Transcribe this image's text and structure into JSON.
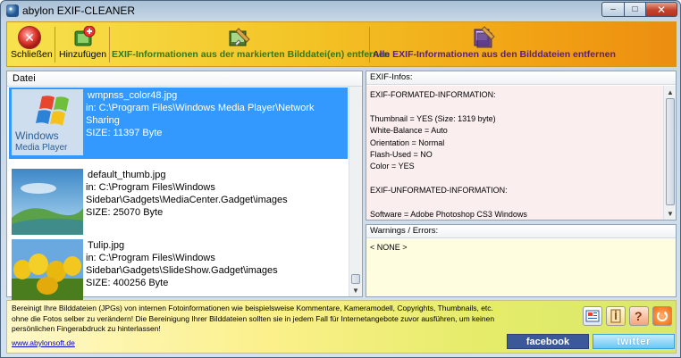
{
  "window": {
    "title": "abylon EXIF-CLEANER",
    "minimize_glyph": "–",
    "maximize_glyph": "□",
    "close_glyph": "✕"
  },
  "toolbar": {
    "close_label": "Schließen",
    "close_glyph": "✕",
    "add_label": "Hinzufügen",
    "remove_selected_label": "EXIF-Informationen aus der markierten Bilddatei(en) entfernen",
    "remove_all_label": "Alle EXIF-Informationen aus den Bilddateien entfernen",
    "remove_selected_color": "#2f7a1f",
    "remove_all_color": "#5b1c8c"
  },
  "file_list": {
    "header": "Datei",
    "files": [
      {
        "name": "wmpnss_color48.jpg",
        "path": "in: C:\\Program Files\\Windows Media Player\\Network Sharing",
        "size": "SIZE: 11397 Byte",
        "thumb_text_1": "Windows",
        "thumb_text_2": "Media Player",
        "selected": true
      },
      {
        "name": "default_thumb.jpg",
        "path": "in: C:\\Program Files\\Windows Sidebar\\Gadgets\\MediaCenter.Gadget\\images",
        "size": "SIZE: 25070 Byte",
        "selected": false
      },
      {
        "name": "Tulip.jpg",
        "path": "in: C:\\Program Files\\Windows Sidebar\\Gadgets\\SlideShow.Gadget\\images",
        "size": "SIZE: 400256 Byte",
        "selected": false
      }
    ],
    "selection_color": "#3399ff"
  },
  "exif": {
    "header": "EXIF-Infos:",
    "content": "EXIF-FORMATED-INFORMATION:\n\nThumbnail = YES (Size: 1319 byte)\nWhite-Balance = Auto\nOrientation = Normal\nFlash-Used = NO\nColor = YES\n\nEXIF-UNFORMATED-INFORMATION:\n\nSoftware = Adobe Photoshop CS3 Windows"
  },
  "warnings": {
    "header": "Warnings / Errors:",
    "content": "< NONE >"
  },
  "footer": {
    "text": "Bereinigt Ihre Bilddateien (JPGs) von internen Fotoinformationen wie beispielsweise Kommentare, Kameramodell, Copyrights, Thumbnails, etc. ohne die Fotos selber zu verändern! Die Bereinigung Ihrer Bilddateien sollten sie in jedem Fall für Internetangebote zuvor ausführen, um keinen persönlichen Fingerabdruck zu hinterlassen!",
    "link": "www.abylonsoft.de",
    "facebook_label": "facebook",
    "twitter_label": "twitter",
    "icons": [
      "info-icon",
      "help-book-icon",
      "question-icon",
      "update-icon"
    ]
  }
}
